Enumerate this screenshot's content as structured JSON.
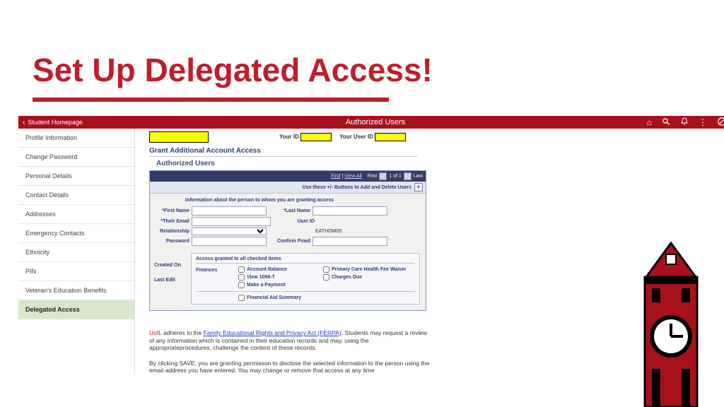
{
  "slide": {
    "title": "Set Up Delegated Access!"
  },
  "topbar": {
    "back": "Student Homepage",
    "title": "Authorized Users"
  },
  "sidebar": {
    "items": [
      "Profile Information",
      "Change Password",
      "Personal Details",
      "Contact Details",
      "Addresses",
      "Emergency Contacts",
      "Ethnicity",
      "PIN",
      "Veteran's Education Benefits",
      "Delegated Access"
    ],
    "selected_index": 9
  },
  "header": {
    "your_id_label": "Your ID",
    "your_user_id_label": "Your User ID"
  },
  "section": {
    "grant": "Grant Additional Account Access",
    "auth": "Authorized Users"
  },
  "panel_bar": {
    "find": "Find",
    "view_all": "View All",
    "first": "First",
    "count": "1 of 1",
    "last": "Last"
  },
  "panel_sub": "Use these +/- Buttons to Add and Delete Users",
  "info_head": "Information about the person to whom you are granting access",
  "fields": {
    "first_name": "First Name",
    "last_name": "Last Name",
    "their_email": "Their Email",
    "user_id": "User ID",
    "relationship": "Relationship",
    "user_id_value": "EATHOM05",
    "password": "Password",
    "confirm": "Confirm Pswd"
  },
  "meta": {
    "created": "Created On",
    "last_edit": "Last Edit"
  },
  "access": {
    "head": "Access granted to all checked items",
    "finances": "Finances",
    "items_left": [
      "Account Balance",
      "View 1098-T",
      "Make a Payment"
    ],
    "items_right": [
      "Primary Care Health Fee Waiver",
      "Charges Due"
    ],
    "fin_aid": "Financial Aid Summary"
  },
  "ferpa": {
    "lead": "UofL",
    "p1a": " adheres to the ",
    "link": "Family Educational Rights and Privacy Act (FERPA)",
    "p1b": ".  Students may request a review of any information which is contained in their education records and may, using the appropriateprocedures, challenge the content of these records.",
    "p2": "By clicking SAVE, you are granting permisson to disclose the selected information to the person using the email address you have entered. You may change or remove that access at any time"
  }
}
